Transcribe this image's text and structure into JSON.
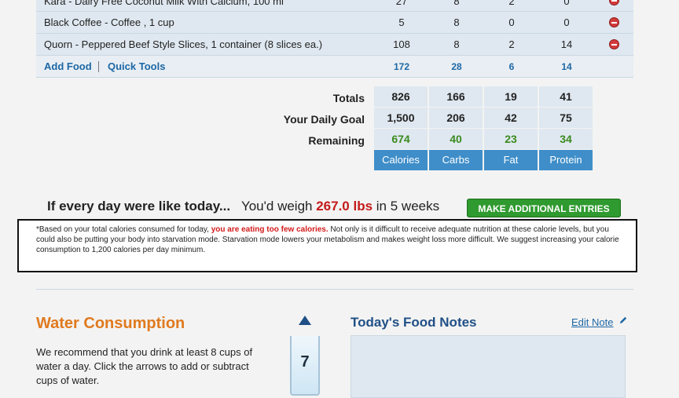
{
  "food": {
    "rows": [
      {
        "name": "Kara - Dairy Free Coconut Milk With Calcium, 100 ml",
        "calories": "27",
        "carbs": "8",
        "fat": "2",
        "protein": "0"
      },
      {
        "name": "Black Coffee - Coffee , 1 cup",
        "calories": "5",
        "carbs": "8",
        "fat": "0",
        "protein": "0"
      },
      {
        "name": "Quorn - Peppered Beef Style Slices, 1 container (8 slices ea.)",
        "calories": "108",
        "carbs": "8",
        "fat": "2",
        "protein": "14"
      }
    ],
    "add_food": "Add Food",
    "quick_tools": "Quick Tools",
    "subtotals": {
      "calories": "172",
      "carbs": "28",
      "fat": "6",
      "protein": "14"
    }
  },
  "totals": {
    "totals_label": "Totals",
    "goal_label": "Your Daily Goal",
    "remaining_label": "Remaining",
    "totals": {
      "calories": "826",
      "carbs": "166",
      "fat": "19",
      "protein": "41"
    },
    "goal": {
      "calories": "1,500",
      "carbs": "206",
      "fat": "42",
      "protein": "75"
    },
    "remaining": {
      "calories": "674",
      "carbs": "40",
      "fat": "23",
      "protein": "34"
    },
    "headers": {
      "calories": "Calories",
      "carbs": "Carbs",
      "fat": "Fat",
      "protein": "Protein"
    }
  },
  "forecast": {
    "lead": "If every day were like today...",
    "prefix": "You'd weigh",
    "weight": "267.0 lbs",
    "suffix": "in 5 weeks",
    "button": "MAKE ADDITIONAL ENTRIES"
  },
  "notice": {
    "pre": "*Based on your total calories consumed for today, ",
    "warn": "you are eating too few calories.",
    "post": " Not only is it difficult to receive adequate nutrition at these calorie levels, but you could also be putting your body into starvation mode. Starvation mode lowers your metabolism and makes weight loss more difficult. We suggest increasing your calorie consumption to 1,200 calories per day minimum."
  },
  "water": {
    "title": "Water Consumption",
    "text": "We recommend that you drink at least 8 cups of water a day. Click the arrows to add or subtract cups of water.",
    "cups": "7"
  },
  "notes": {
    "title": "Today's Food Notes",
    "edit": "Edit Note"
  },
  "colors": {
    "accent_blue": "#3f8ec9",
    "remaining_green": "#3a8a1d",
    "warning_red": "#c41a1a",
    "water_orange": "#e07a1e"
  }
}
